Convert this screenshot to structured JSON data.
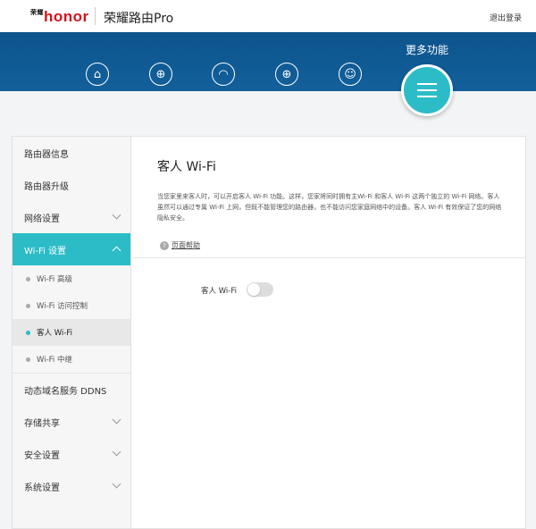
{
  "header": {
    "brand": "honor",
    "brand_cn": "荣耀",
    "product": "荣耀路由Pro",
    "logout": "退出登录"
  },
  "nav": {
    "icons": [
      "home-icon",
      "globe-icon",
      "wifi-icon",
      "globe-speed-icon",
      "user-icon"
    ],
    "more_label": "更多功能"
  },
  "sidebar": {
    "items_top": [
      {
        "label": "路由器信息"
      },
      {
        "label": "路由器升级"
      },
      {
        "label": "网络设置"
      },
      {
        "label": "Wi-Fi 设置"
      }
    ],
    "subitems": [
      {
        "label": "Wi-Fi 高级"
      },
      {
        "label": "Wi-Fi 访问控制"
      },
      {
        "label": "客人 Wi-Fi"
      },
      {
        "label": "Wi-Fi 中继"
      }
    ],
    "items_bottom": [
      {
        "label": "动态域名服务 DDNS"
      },
      {
        "label": "存储共享"
      },
      {
        "label": "安全设置"
      },
      {
        "label": "系统设置"
      }
    ]
  },
  "main": {
    "title": "客人 Wi-Fi",
    "description": "当您家里来客人时，可以开启客人 Wi-Fi 功能。这样，您家将同时拥有主Wi-Fi 和客人 Wi-Fi 这两个独立的 Wi-Fi 网络。客人虽然可以通过专属 Wi-Fi 上网，但既不能管理您的路由器，也不能访问您家庭网络中的设备。客人 Wi-Fi 有效保证了您的网络隐私安全。",
    "help": "页面帮助",
    "guest_wifi_label": "客人 Wi-Fi",
    "guest_wifi_enabled": false
  },
  "colors": {
    "accent": "#2cbcc7",
    "banner": "#0e5a94"
  }
}
